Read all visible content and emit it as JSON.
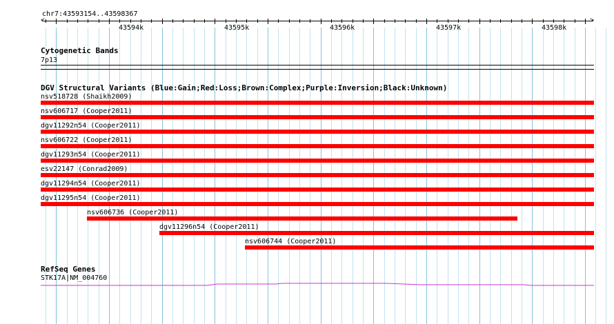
{
  "ruler": {
    "position": "chr7:43593154..43598367",
    "labels": [
      "43594k",
      "43595k",
      "43596k",
      "43597k",
      "43598k"
    ]
  },
  "cyto": {
    "title": "Cytogenetic Bands",
    "band": "7p13"
  },
  "dgv": {
    "title": "DGV Structural Variants (Blue:Gain;Red:Loss;Brown:Complex;Purple:Inversion;Black:Unknown)",
    "bar_color": "#ff0000",
    "features": [
      {
        "label": "nsv518728 (Shaikh2009)"
      },
      {
        "label": "nsv606717 (Cooper2011)"
      },
      {
        "label": "dgv11292n54 (Cooper2011)"
      },
      {
        "label": "nsv606722 (Cooper2011)"
      },
      {
        "label": "dgv11293n54 (Cooper2011)"
      },
      {
        "label": "esv22147 (Conrad2009)"
      },
      {
        "label": "dgv11294n54 (Cooper2011)"
      },
      {
        "label": "dgv11295n54 (Cooper2011)"
      },
      {
        "label": "nsv606736 (Cooper2011)"
      },
      {
        "label": "dgv11296n54 (Cooper2011)"
      },
      {
        "label": "nsv606744 (Cooper2011)"
      }
    ]
  },
  "refseq": {
    "title": "RefSeq Genes",
    "gene": "STK17A|NM_004760",
    "line_color": "#cc33cc"
  },
  "colors": {
    "grid_light": "#bfe3ee",
    "grid_dark": "#7fc4db"
  }
}
